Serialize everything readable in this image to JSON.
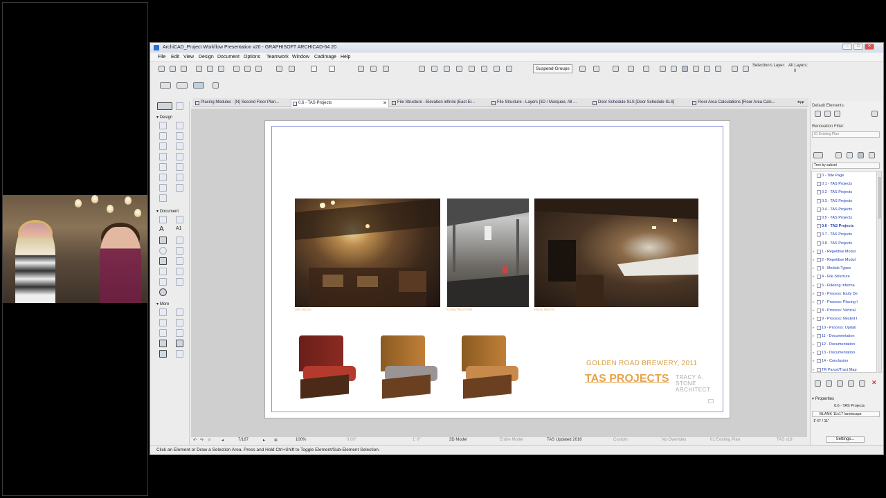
{
  "window": {
    "title": "ArchiCAD_Project Workflow Presentation v20 - GRAPHISOFT ARCHICAD-64 20",
    "controls": [
      "–",
      "□",
      "✕"
    ]
  },
  "menu": [
    "File",
    "Edit",
    "View",
    "Design",
    "Document",
    "Options",
    "Teamwork",
    "Window",
    "Cadimage",
    "Help"
  ],
  "toolbar": {
    "suspend_groups": "Suspend Groups",
    "selections_layer": "Selection's Layer:",
    "all_layers": "All Layers:",
    "layer_value": "0"
  },
  "tabs": [
    {
      "label": "Placing Modules - [N] Second Floor Plan...",
      "active": false
    },
    {
      "label": "0.6 - TAS Projects",
      "active": true
    },
    {
      "label": "File Structure - Elevation infinite [East El...",
      "active": false
    },
    {
      "label": "File Structure - Layers [3D / Marquee, All ...",
      "active": false
    },
    {
      "label": "Door Schedule SLS [Door Schedule SLS]",
      "active": false
    },
    {
      "label": "Floor Area Calculations [Floor Area Calc...",
      "active": false
    }
  ],
  "toolbox": {
    "sections": [
      "Design",
      "Document",
      "More"
    ]
  },
  "sheet": {
    "captions": [
      "ARCHICAD",
      "CONSTRUCTION",
      "FINAL PHOTO"
    ],
    "project_line": "GOLDEN ROAD BREWERY, 2011",
    "brand": "TAS PROJECTS",
    "architect_name": "TRACY A. STONE ARCHITECT"
  },
  "navbar": {
    "page": "7/187",
    "zoom": "100%",
    "angle": "0.00°",
    "scale": "1' 0\"",
    "model_view": "3D Model",
    "structure": "Entire Model",
    "layer_combo": "TAS Updated 2016",
    "pen_set": "Custom",
    "override": "No Overrides",
    "renovation": "01 Existing Plan",
    "mvo": "TAS v19"
  },
  "status": "Click an Element or Draw a Selection Area. Press and Hold Ctrl+Shift to Toggle Element/Sub-Element Selection.",
  "right_panel": {
    "default_elements": "Default Elements:",
    "renovation_filter": "Renovation Filter:",
    "renovation_value": "01 Existing Plan",
    "tree_mode": "Tree by subset",
    "tree": [
      "0 - Title Page",
      "0.1 - TAS Projects",
      "0.2 - TAS Projects",
      "0.3 - TAS Projects",
      "0.4 - TAS Projects",
      "0.5 - TAS Projects",
      "0.6 - TAS Projects",
      "0.7 - TAS Projects",
      "0.8 - TAS Projects",
      "1 - Repetitive Modul",
      "2 - Repetitive Modul",
      "3 - Module Types",
      "4 - File Structure",
      "5 - Filtering Informa",
      "6 - Process: Early De",
      "7 - Process: Placing I",
      "8 - Process: Vertical",
      "9 - Process: Nested I",
      "10 - Process: Updati",
      "11 - Documentation",
      "12 - Documentation",
      "13 - Documentation",
      "14 - Conclusion",
      "TR Parcel/Tract Map"
    ],
    "selected_index": 6,
    "properties": "Properties",
    "prop_name": "0.6 - TAS Projects",
    "prop_layout": "BLANK 11x17 landscape",
    "prop_scale": "1'-5\" / 11\"",
    "settings": "Settings..."
  },
  "colors": {
    "accent_orange": "#e6a24a",
    "tree_link": "#1b3fb5",
    "sheet_border": "#8f8fe0"
  }
}
